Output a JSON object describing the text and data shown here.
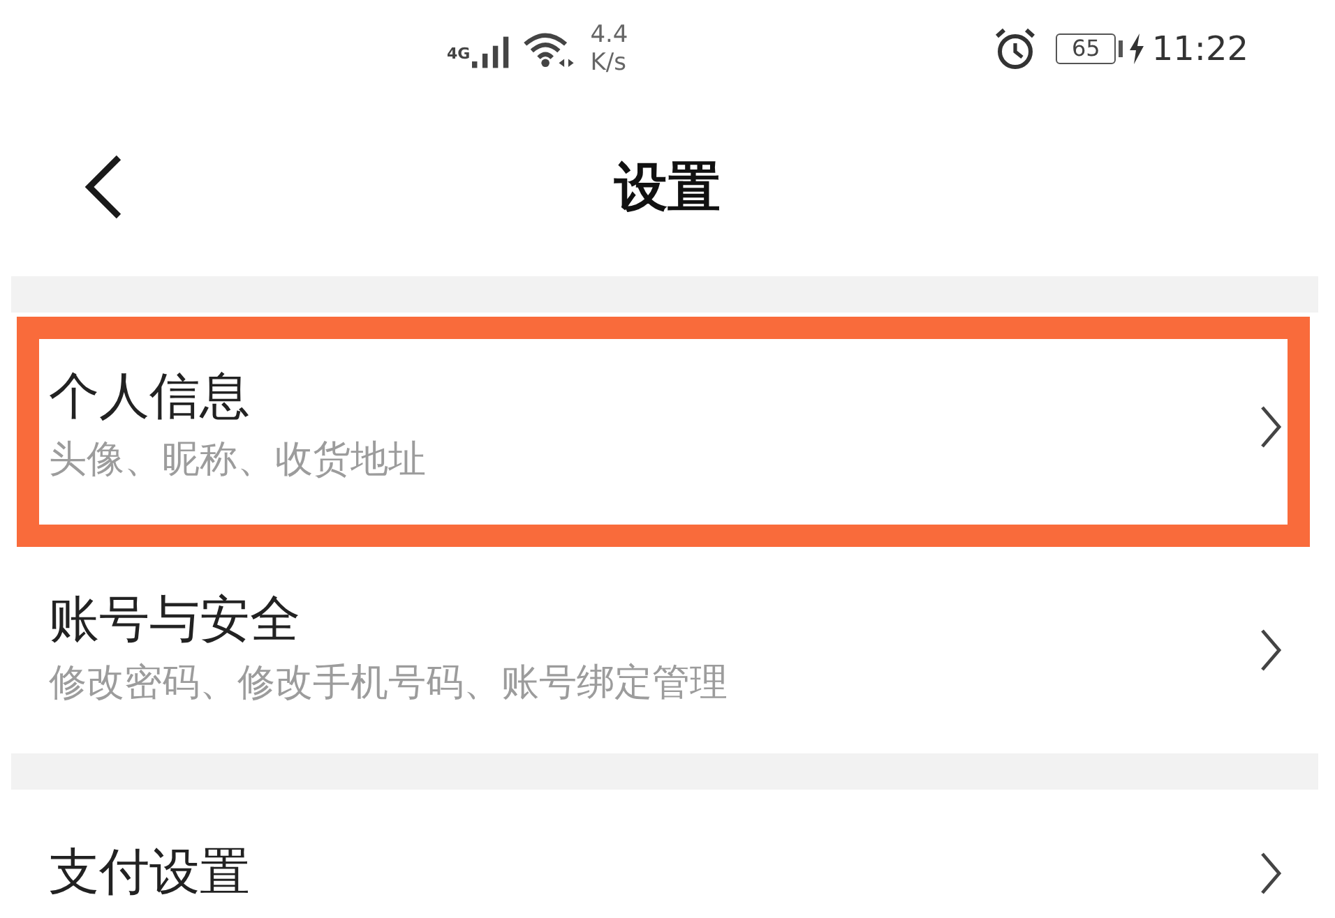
{
  "status_bar": {
    "network": "4G",
    "speed_value": "4.4",
    "speed_unit": "K/s",
    "battery": "65",
    "charging": true,
    "time": "11:22"
  },
  "header": {
    "title": "设置"
  },
  "groups": [
    {
      "items": [
        {
          "title": "个人信息",
          "subtitle": "头像、昵称、收货地址",
          "highlighted": true
        },
        {
          "title": "账号与安全",
          "subtitle": "修改密码、修改手机号码、账号绑定管理",
          "highlighted": false
        }
      ]
    },
    {
      "items": [
        {
          "title": "支付设置",
          "highlighted": false
        }
      ]
    }
  ]
}
